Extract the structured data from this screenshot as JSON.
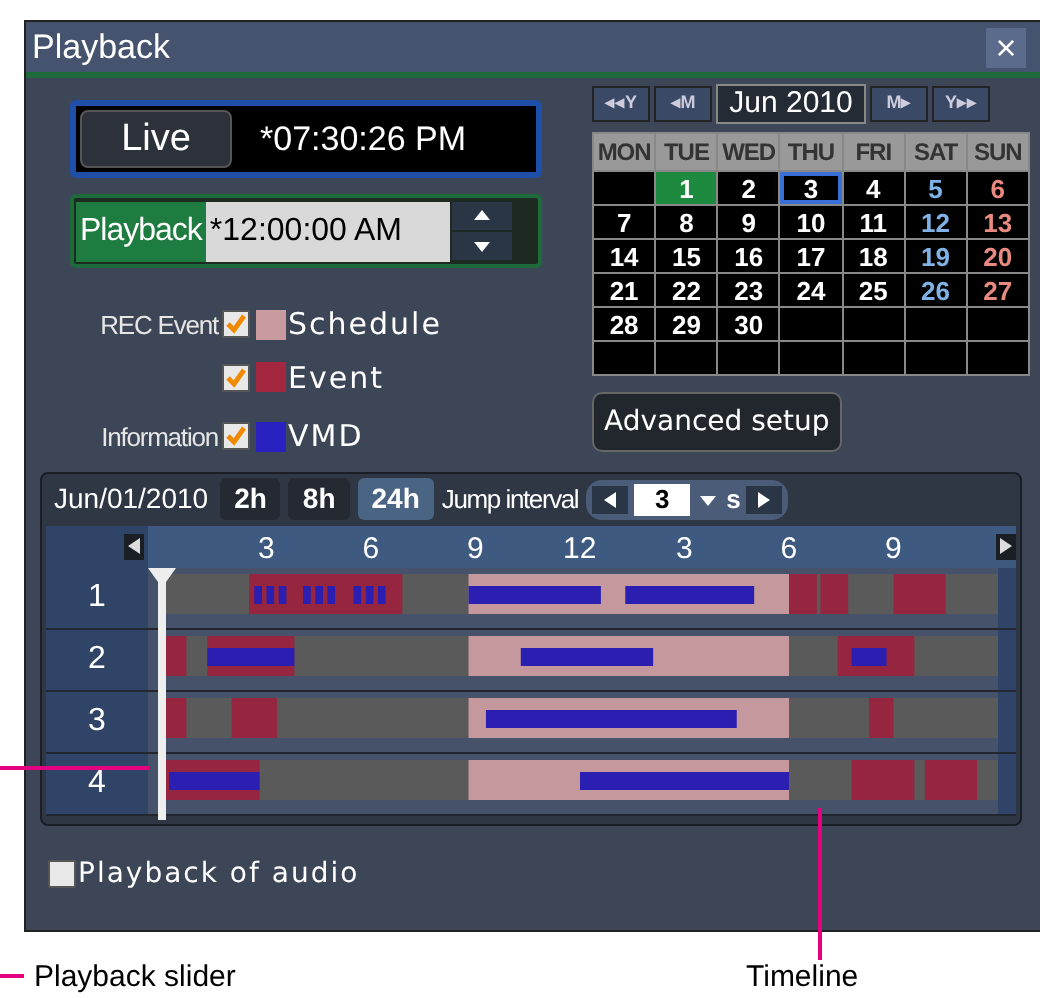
{
  "window": {
    "title": "Playback",
    "close": "×"
  },
  "live": {
    "button": "Live",
    "time": "*07:30:26 PM"
  },
  "playback": {
    "button": "Playback",
    "time": "*12:00:00 AM"
  },
  "legend": [
    {
      "group": "REC Event",
      "checked": true,
      "color": "#c99a9e",
      "label": "Schedule"
    },
    {
      "checked": true,
      "color": "#a3283f",
      "label": "Event"
    },
    {
      "group": "Information",
      "checked": true,
      "color": "#2a22c0",
      "label": "VMD"
    }
  ],
  "calendar": {
    "prev": [
      "◂◂Y",
      "◂M"
    ],
    "month": "Jun 2010",
    "next": [
      "M▸",
      "Y▸▸"
    ],
    "weekdays": [
      "MON",
      "TUE",
      "WED",
      "THU",
      "FRI",
      "SAT",
      "SUN"
    ],
    "cells": [
      {
        "kind": "blank"
      },
      {
        "kind": "day",
        "label": "1",
        "selected": true,
        "today": false
      },
      {
        "kind": "day",
        "label": "2",
        "selected": false,
        "today": false
      },
      {
        "kind": "day",
        "label": "3",
        "selected": false,
        "today": true
      },
      {
        "kind": "day",
        "label": "4",
        "selected": false,
        "today": false
      },
      {
        "kind": "day",
        "label": "5",
        "selected": false,
        "today": false
      },
      {
        "kind": "day",
        "label": "6",
        "selected": false,
        "today": false
      },
      {
        "kind": "day",
        "label": "7",
        "selected": false,
        "today": false
      },
      {
        "kind": "day",
        "label": "8",
        "selected": false,
        "today": false
      },
      {
        "kind": "day",
        "label": "9",
        "selected": false,
        "today": false
      },
      {
        "kind": "day",
        "label": "10",
        "selected": false,
        "today": false
      },
      {
        "kind": "day",
        "label": "11",
        "selected": false,
        "today": false
      },
      {
        "kind": "day",
        "label": "12",
        "selected": false,
        "today": false
      },
      {
        "kind": "day",
        "label": "13",
        "selected": false,
        "today": false
      },
      {
        "kind": "day",
        "label": "14",
        "selected": false,
        "today": false
      },
      {
        "kind": "day",
        "label": "15",
        "selected": false,
        "today": false
      },
      {
        "kind": "day",
        "label": "16",
        "selected": false,
        "today": false
      },
      {
        "kind": "day",
        "label": "17",
        "selected": false,
        "today": false
      },
      {
        "kind": "day",
        "label": "18",
        "selected": false,
        "today": false
      },
      {
        "kind": "day",
        "label": "19",
        "selected": false,
        "today": false
      },
      {
        "kind": "day",
        "label": "20",
        "selected": false,
        "today": false
      },
      {
        "kind": "day",
        "label": "21",
        "selected": false,
        "today": false
      },
      {
        "kind": "day",
        "label": "22",
        "selected": false,
        "today": false
      },
      {
        "kind": "day",
        "label": "23",
        "selected": false,
        "today": false
      },
      {
        "kind": "day",
        "label": "24",
        "selected": false,
        "today": false
      },
      {
        "kind": "day",
        "label": "25",
        "selected": false,
        "today": false
      },
      {
        "kind": "day",
        "label": "26",
        "selected": false,
        "today": false
      },
      {
        "kind": "day",
        "label": "27",
        "selected": false,
        "today": false
      },
      {
        "kind": "day",
        "label": "28",
        "selected": false,
        "today": false
      },
      {
        "kind": "day",
        "label": "29",
        "selected": false,
        "today": false
      },
      {
        "kind": "day",
        "label": "30",
        "selected": false,
        "today": false
      },
      {
        "kind": "blank"
      },
      {
        "kind": "blank"
      },
      {
        "kind": "blank"
      },
      {
        "kind": "blank"
      },
      {
        "kind": "blank"
      },
      {
        "kind": "blank"
      },
      {
        "kind": "blank"
      },
      {
        "kind": "blank"
      },
      {
        "kind": "blank"
      },
      {
        "kind": "blank"
      },
      {
        "kind": "blank"
      }
    ]
  },
  "advanced_button": "Advanced setup",
  "timeline": {
    "date": "Jun/01/2010",
    "zooms": [
      {
        "label": "2h",
        "selected": false
      },
      {
        "label": "8h",
        "selected": false
      },
      {
        "label": "24h",
        "selected": true
      }
    ],
    "jump_label": "Jump interval",
    "jump_value": "3",
    "jump_unit": "s",
    "ruler": [
      "3",
      "6",
      "9",
      "12",
      "3",
      "6",
      "9"
    ],
    "channels": [
      "1",
      "2",
      "3",
      "4"
    ]
  },
  "audio": {
    "label": "Playback of audio",
    "checked": false
  },
  "callouts": [
    {
      "label": "Playback slider"
    },
    {
      "label": "Timeline"
    }
  ]
}
